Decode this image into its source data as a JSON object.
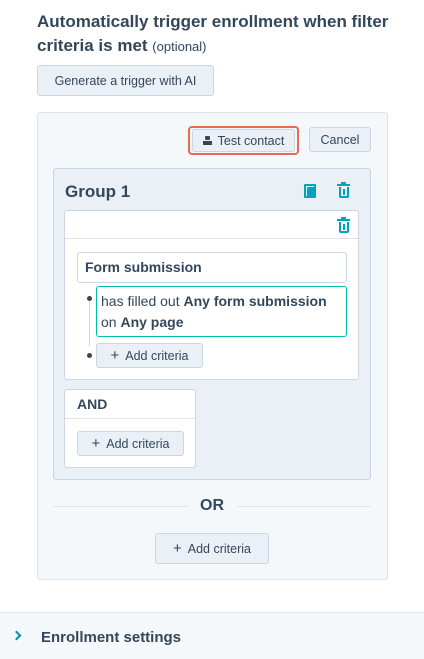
{
  "header": {
    "title": "Automatically trigger enrollment when filter criteria is met",
    "optional": "(optional)"
  },
  "buttons": {
    "generate_ai": "Generate a trigger with AI",
    "test_contact": "Test contact",
    "cancel": "Cancel"
  },
  "group": {
    "title": "Group 1",
    "filter": {
      "category": "Form submission",
      "text_1": "has filled out ",
      "bold_1": "Any form submission",
      "text_2": "on ",
      "bold_2": "Any page"
    },
    "add_criteria": "Add criteria",
    "and_label": "AND",
    "and_add_criteria": "Add criteria"
  },
  "or_label": "OR",
  "or_add_criteria": "Add criteria",
  "footer": {
    "label": "Enrollment settings"
  },
  "icons": {
    "test": "flask-icon",
    "copy": "copy-icon",
    "delete": "trash-icon",
    "add": "plus-icon",
    "expand": "chevron-right-icon"
  },
  "colors": {
    "accent": "#00a4bd",
    "highlight": "#e66e50",
    "text": "#33475b",
    "button_bg": "#eaf0f6",
    "filter_border": "#00bda5"
  }
}
